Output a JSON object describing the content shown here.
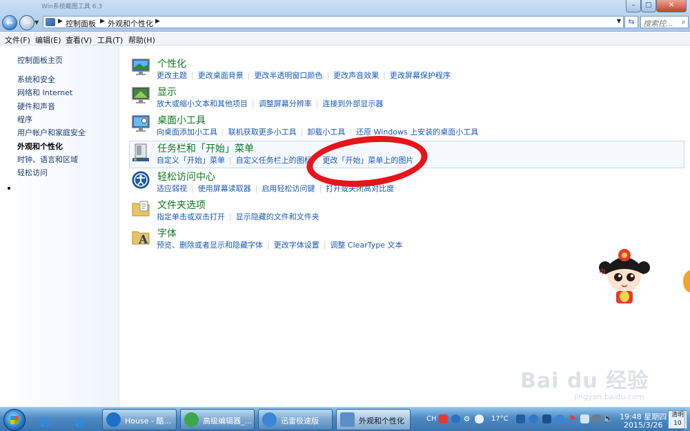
{
  "window": {
    "title": "Win系统截图工具 6.3"
  },
  "address": {
    "breadcrumbs": [
      "控制面板",
      "外观和个性化"
    ],
    "search_placeholder": "搜索控..."
  },
  "menu": [
    "文件(F)",
    "编辑(E)",
    "查看(V)",
    "工具(T)",
    "帮助(H)"
  ],
  "sidebar": {
    "home": "控制面板主页",
    "items": [
      "系统和安全",
      "网络和 Internet",
      "硬件和声音",
      "程序",
      "用户帐户和家庭安全",
      "外观和个性化",
      "时钟、语言和区域",
      "轻松访问"
    ],
    "current_index": 5
  },
  "categories": [
    {
      "title": "个性化",
      "icon": "personalization-icon",
      "links": [
        "更改主题",
        "更改桌面背景",
        "更改半透明窗口颜色",
        "更改声音效果",
        "更改屏幕保护程序"
      ]
    },
    {
      "title": "显示",
      "icon": "display-icon",
      "links": [
        "放大或缩小文本和其他项目",
        "调整屏幕分辨率",
        "连接到外部显示器"
      ]
    },
    {
      "title": "桌面小工具",
      "icon": "gadgets-icon",
      "links": [
        "向桌面添加小工具",
        "联机获取更多小工具",
        "卸载小工具",
        "还原 Windows 上安装的桌面小工具"
      ]
    },
    {
      "title": "任务栏和「开始」菜单",
      "icon": "taskbar-icon",
      "links": [
        "自定义「开始」菜单",
        "自定义任务栏上的图标",
        "更改「开始」菜单上的图片"
      ]
    },
    {
      "title": "轻松访问中心",
      "icon": "ease-of-access-icon",
      "links": [
        "适应弱视",
        "使用屏幕读取器",
        "启用轻松访问键",
        "打开或关闭高对比度"
      ]
    },
    {
      "title": "文件夹选项",
      "icon": "folder-options-icon",
      "links": [
        "指定单击或双击打开",
        "显示隐藏的文件和文件夹"
      ]
    },
    {
      "title": "字体",
      "icon": "fonts-icon",
      "links": [
        "预览、删除或者显示和隐藏字体",
        "更改字体设置",
        "调整 ClearType 文本"
      ]
    }
  ],
  "watermark": {
    "brand": "Bai du 经验",
    "url": "jingyan.baidu.com"
  },
  "taskbar": {
    "tasks": [
      {
        "label": "House - 酷...",
        "icon_color": "#1e6fc6"
      },
      {
        "label": "高级编辑器_...",
        "icon_color": "#3aa84a"
      },
      {
        "label": "迅雷极速版",
        "icon_color": "#3a86d4"
      },
      {
        "label": "外观和个性化",
        "icon_color": "#5b8ec7"
      }
    ],
    "tray": {
      "lang": "CH",
      "temperature": "17°C",
      "time": "19:48 星期四",
      "date": "2015/3/26",
      "weather": "清明",
      "weather_num": "10"
    }
  }
}
